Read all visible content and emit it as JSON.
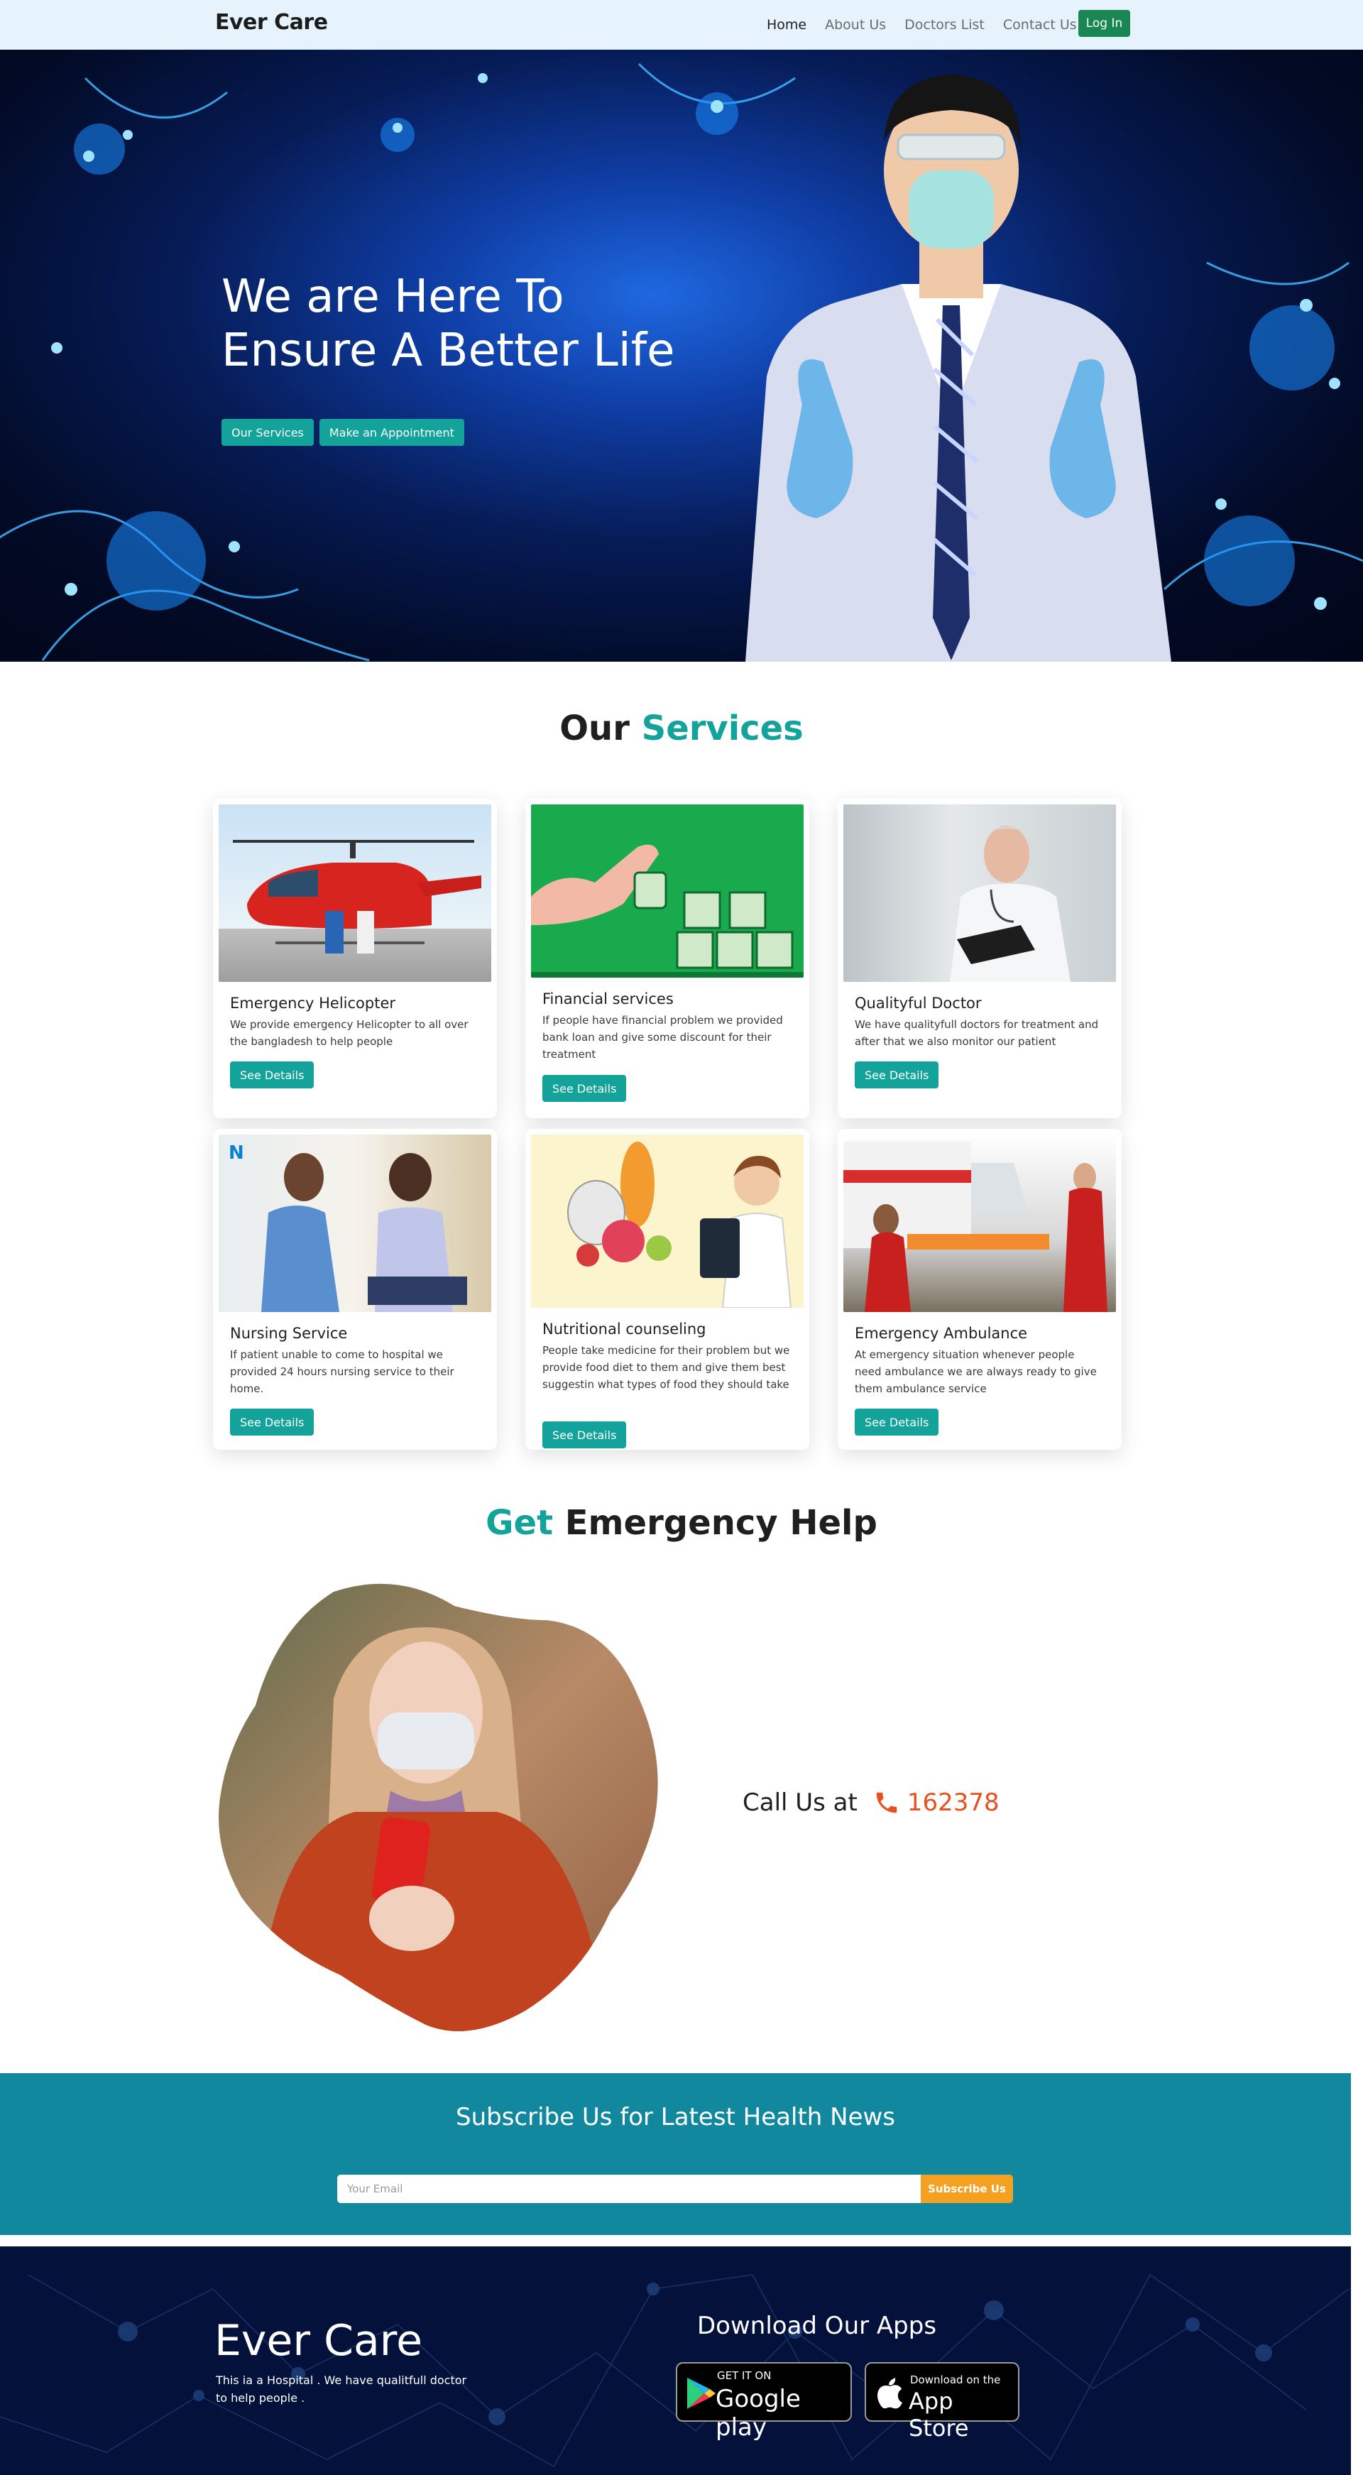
{
  "navbar": {
    "brand": "Ever Care",
    "links": [
      "Home",
      "About Us",
      "Doctors List",
      "Contact Us"
    ],
    "login_label": "Log In"
  },
  "hero": {
    "title_line1": "We are Here To",
    "title_line2": "Ensure A Better Life",
    "buttons": [
      "Our Services",
      "Make an Appointment"
    ]
  },
  "services": {
    "title_prefix": "Our",
    "title_accent": "Services",
    "button_label": "See Details",
    "cards": [
      {
        "title": "Emergency Helicopter",
        "text": "We provide emergency Helicopter to all over the bangladesh to help people"
      },
      {
        "title": "Financial services",
        "text": "If people have financial problem we provided bank loan and give some discount for their treatment"
      },
      {
        "title": "Qualityful Doctor",
        "text": "We have qualityfull doctors for treatment and after that we also monitor our patient"
      },
      {
        "title": "Nursing Service",
        "text": "If patient unable to come to hospital we provided 24 hours nursing service to their home."
      },
      {
        "title": "Nutritional counseling",
        "text": "People take medicine for their problem but we provide food diet to them and give them best suggestin what types of food they should take"
      },
      {
        "title": "Emergency Ambulance",
        "text": "At emergency situation whenever people need ambulance we are always ready to give them ambulance service"
      }
    ]
  },
  "emergency": {
    "title_accent": "Get",
    "title_rest": "Emergency Help",
    "call_label": "Call Us at",
    "phone": "162378"
  },
  "subscribe": {
    "title": "Subscribe Us for Latest Health News",
    "placeholder": "Your Email",
    "button_label": "Subscribe Us"
  },
  "footer": {
    "brand": "Ever Care",
    "description": "This ia a Hospital . We have qualitfull doctor to help people .",
    "apps_title": "Download Our Apps",
    "google_small": "GET IT ON",
    "google_big": "Google play",
    "apple_small": "Download on the",
    "apple_big": "App Store"
  },
  "colors": {
    "accent": "#13a39a",
    "login": "#198754",
    "phone": "#e8501e",
    "subscribe_bg": "#12889e",
    "subscribe_btn": "#f4a020",
    "footer_bg": "#04123b"
  }
}
